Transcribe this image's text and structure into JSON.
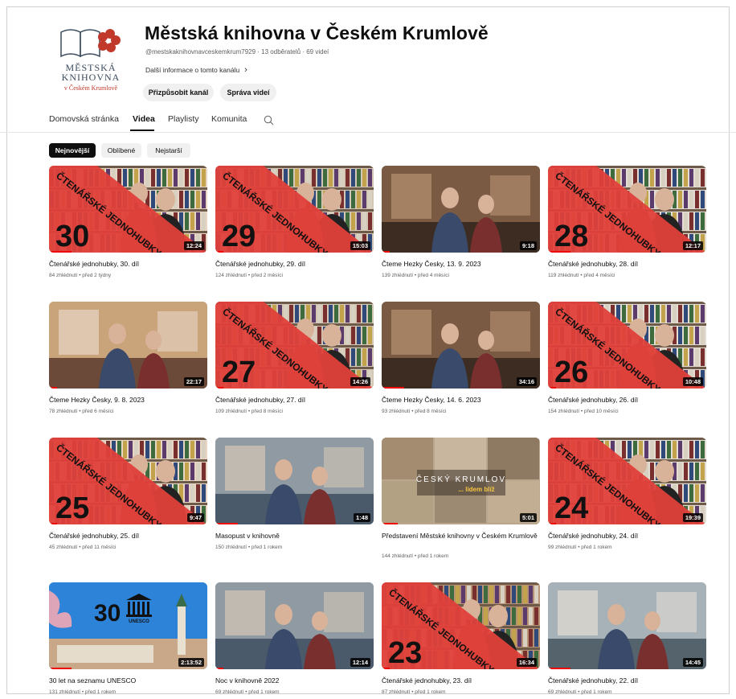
{
  "channel": {
    "logo_line1": "MĚSTSKÁ",
    "logo_line2": "KNIHOVNA",
    "logo_line3": "v Českém Krumlově",
    "title": "Městská knihovna v Českém Krumlově",
    "meta": "@mestskaknihovnavceskemkrum7929 · 13 odběratelů · 69 videí",
    "more_info": "Další informace o tomto kanálu",
    "customize_label": "Přizpůsobit kanál",
    "manage_label": "Správa videí"
  },
  "tabs": [
    {
      "label": "Domovská stránka",
      "active": false
    },
    {
      "label": "Videa",
      "active": true
    },
    {
      "label": "Playlisty",
      "active": false
    },
    {
      "label": "Komunita",
      "active": false
    }
  ],
  "chips": [
    {
      "label": "Nejnovější",
      "active": true
    },
    {
      "label": "Oblíbené",
      "active": false
    },
    {
      "label": "Nejstarší",
      "active": false
    }
  ],
  "banner_text": "ČTENÁŘSKÉ JEDNOHUBKY",
  "thumb_texts": {
    "krumlov": "ČESKÝ KRUMLOV",
    "krumlov_sub": "... lidem blíž",
    "unesco_num": "30",
    "unesco_label": "UNESCO"
  },
  "colors": {
    "banner_red": "#e0403a",
    "progress_red": "#ff0000"
  },
  "videos": [
    {
      "title": "Čtenářské jednohubky, 30. díl",
      "meta": "84 zhlédnutí • před 2 týdny",
      "duration": "12:24",
      "episode": "30",
      "type": "cj"
    },
    {
      "title": "Čtenářské jednohubky, 29. díl",
      "meta": "124 zhlédnutí • před 2 měsíci",
      "duration": "15:03",
      "episode": "29",
      "type": "cj"
    },
    {
      "title": "Čteme Hezky Česky, 13. 9. 2023",
      "meta": "139 zhlédnutí • před 4 měsíci",
      "duration": "9:18",
      "type": "photo"
    },
    {
      "title": "Čtenářské jednohubky, 28. díl",
      "meta": "119 zhlédnutí • před 4 měsíci",
      "duration": "12:17",
      "episode": "28",
      "type": "cj"
    },
    {
      "title": "Čteme Hezky Česky, 9. 8. 2023",
      "meta": "78 zhlédnutí • před 6 měsíci",
      "duration": "22:17",
      "type": "photo"
    },
    {
      "title": "Čtenářské jednohubky, 27. díl",
      "meta": "109 zhlédnutí • před 8 měsíci",
      "duration": "14:26",
      "episode": "27",
      "type": "cj"
    },
    {
      "title": "Čteme Hezky Česky, 14. 6. 2023",
      "meta": "93 zhlédnutí • před 8 měsíci",
      "duration": "34:16",
      "type": "photo"
    },
    {
      "title": "Čtenářské jednohubky, 26. díl",
      "meta": "154 zhlédnutí • před 10 měsíci",
      "duration": "10:48",
      "episode": "26",
      "type": "cj"
    },
    {
      "title": "Čtenářské jednohubky, 25. díl",
      "meta": "45 zhlédnutí • před 11 měsíci",
      "duration": "9:47",
      "episode": "25",
      "type": "cj"
    },
    {
      "title": "Masopust v knihovně",
      "meta": "150 zhlédnutí • před 1 rokem",
      "duration": "1:48",
      "type": "photo"
    },
    {
      "title": "Představení Městské knihovny v Českém Krumlově",
      "meta": "144 zhlédnutí • před 1 rokem",
      "duration": "5:01",
      "type": "krumlov"
    },
    {
      "title": "Čtenářské jednohubky, 24. díl",
      "meta": "99 zhlédnutí • před 1 rokem",
      "duration": "19:39",
      "episode": "24",
      "type": "cj"
    },
    {
      "title": "30 let na seznamu UNESCO",
      "meta": "131 zhlédnutí • před 1 rokem",
      "duration": "2:13:52",
      "type": "unesco"
    },
    {
      "title": "Noc v knihovně 2022",
      "meta": "69 zhlédnutí • před 1 rokem",
      "duration": "12:14",
      "type": "photo"
    },
    {
      "title": "Čtenářské jednohubky, 23. díl",
      "meta": "87 zhlédnutí • před 1 rokem",
      "duration": "16:34",
      "episode": "23",
      "type": "cj"
    },
    {
      "title": "Čtenářské jednohubky, 22. díl",
      "meta": "69 zhlédnutí • před 1 rokem",
      "duration": "14:45",
      "type": "photo"
    }
  ]
}
